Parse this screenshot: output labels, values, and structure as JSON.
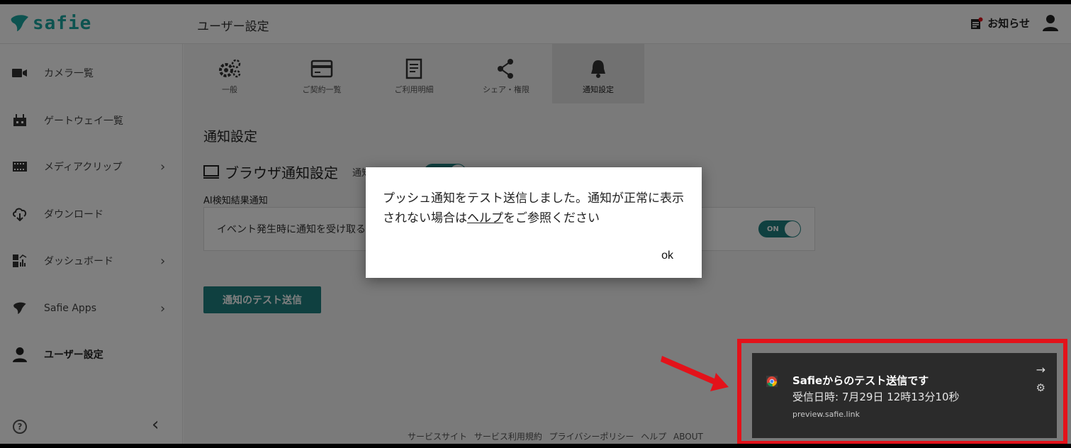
{
  "app": {
    "logo_text": "safie",
    "page_title": "ユーザー設定",
    "news_label": "お知らせ"
  },
  "sidebar": {
    "items": [
      {
        "label": "カメラ一覧",
        "icon": "camera-icon"
      },
      {
        "label": "ゲートウェイ一覧",
        "icon": "gateway-icon"
      },
      {
        "label": "メディアクリップ",
        "icon": "film-icon",
        "has_children": true
      },
      {
        "label": "ダウンロード",
        "icon": "cloud-download-icon"
      },
      {
        "label": "ダッシュボード",
        "icon": "dashboard-icon",
        "has_children": true
      },
      {
        "label": "Safie Apps",
        "icon": "safie-leaf-icon",
        "has_children": true
      },
      {
        "label": "ユーザー設定",
        "icon": "user-icon",
        "active": true
      }
    ],
    "help_label": "?"
  },
  "tabs": [
    {
      "label": "一般",
      "icon": "gears-icon"
    },
    {
      "label": "ご契約一覧",
      "icon": "card-icon"
    },
    {
      "label": "ご利用明細",
      "icon": "document-icon"
    },
    {
      "label": "シェア・権限",
      "icon": "share-icon"
    },
    {
      "label": "通知設定",
      "icon": "bell-icon",
      "active": true
    }
  ],
  "main": {
    "section_title": "通知設定",
    "browser_title": "ブラウザ通知設定",
    "allow_label": "通知を許可する",
    "allow_toggle": "ON",
    "ai_label": "AI検知結果通知",
    "event_text": "イベント発生時に通知を受け取る",
    "event_toggle": "ON",
    "test_button": "通知のテスト送信"
  },
  "footer": {
    "links": "サービスサイト サービス利用規約 プライバシーポリシー ヘルプ ABOUT"
  },
  "dialog": {
    "message_before": "プッシュ通知をテスト送信しました。通知が正常に表示されない場合は",
    "link_text": "ヘルプ",
    "message_after": "をご参照ください",
    "ok_label": "ok"
  },
  "toast": {
    "title": "Safieからのテスト送信です",
    "body": "受信日時: 7月29日 12時13分10秒",
    "url": "preview.safie.link"
  },
  "colors": {
    "accent": "#1f8080",
    "logo": "#1aa6a0",
    "annotation": "#e3121a",
    "toast_bg": "#2b2b2b"
  }
}
